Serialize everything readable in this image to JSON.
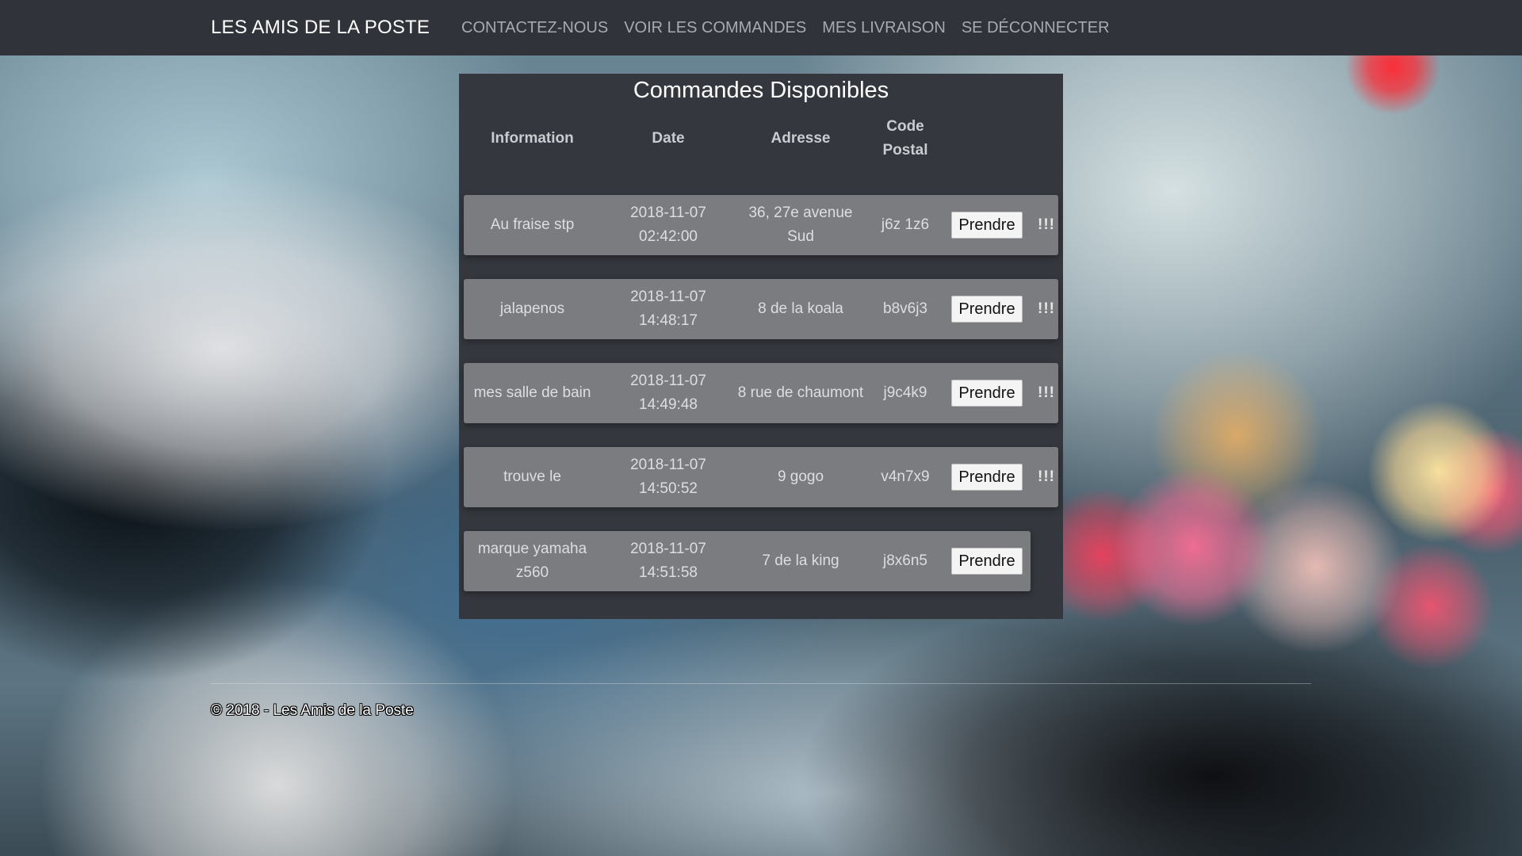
{
  "navbar": {
    "brand": "LES AMIS DE LA POSTE",
    "links": [
      "CONTACTEZ-NOUS",
      "VOIR LES COMMANDES",
      "MES LIVRAISON",
      "SE DÉCONNECTER"
    ]
  },
  "panel": {
    "title": "Commandes Disponibles",
    "headers": {
      "information": "Information",
      "date": "Date",
      "adresse": "Adresse",
      "code_postal": "Code Postal"
    },
    "action_label": "Prendre",
    "flag_label": "!!!",
    "rows": [
      {
        "information": "Au fraise stp",
        "date": "2018-11-07 02:42:00",
        "adresse": "36, 27e avenue Sud",
        "code_postal": "j6z 1z6",
        "flagged": true
      },
      {
        "information": "jalapenos",
        "date": "2018-11-07 14:48:17",
        "adresse": "8 de la koala",
        "code_postal": "b8v6j3",
        "flagged": true
      },
      {
        "information": "mes salle de bain",
        "date": "2018-11-07 14:49:48",
        "adresse": "8 rue de chaumont",
        "code_postal": "j9c4k9",
        "flagged": true
      },
      {
        "information": "trouve le",
        "date": "2018-11-07 14:50:52",
        "adresse": "9 gogo",
        "code_postal": "v4n7x9",
        "flagged": true
      },
      {
        "information": "marque yamaha z560",
        "date": "2018-11-07 14:51:58",
        "adresse": "7 de la king",
        "code_postal": "j8x6n5",
        "flagged": false
      }
    ]
  },
  "footer": {
    "text": "© 2018 - Les Amis de la Poste"
  }
}
